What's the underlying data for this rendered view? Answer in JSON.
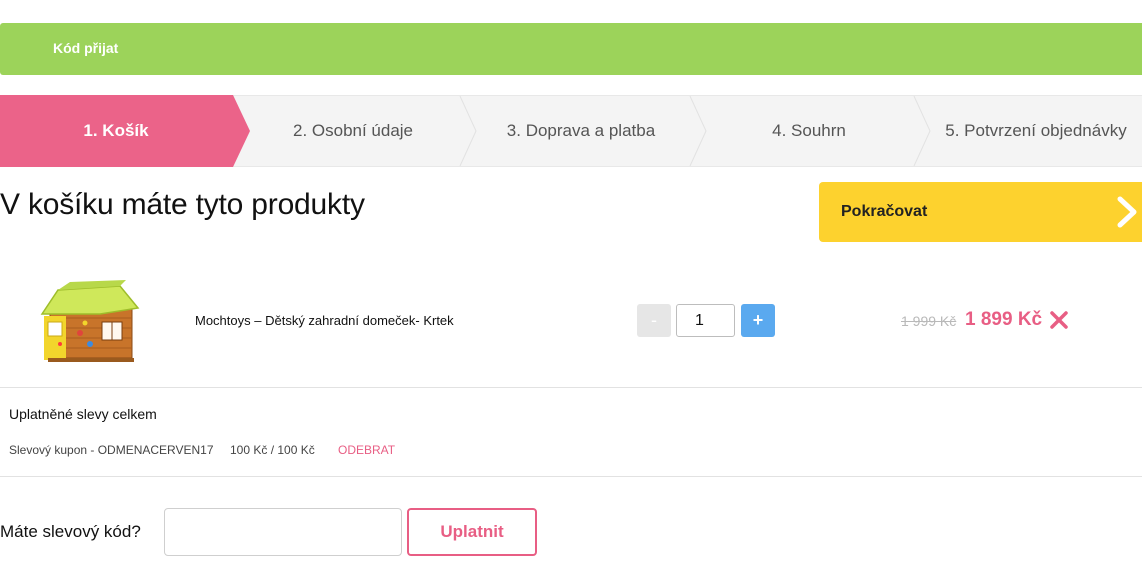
{
  "banner": {
    "text": "Kód přijat",
    "color": "#9cd35a"
  },
  "steps": [
    {
      "label": "1. Košík",
      "active": true
    },
    {
      "label": "2. Osobní údaje",
      "active": false
    },
    {
      "label": "3. Doprava a platba",
      "active": false
    },
    {
      "label": "4. Souhrn",
      "active": false
    },
    {
      "label": "5. Potvrzení objednávky",
      "active": false
    }
  ],
  "cart": {
    "title": "V košíku máte tyto produkty",
    "continue_label": "Pokračovat",
    "product": {
      "name": "Mochtoys – Dětský zahradní domeček- Krtek",
      "image_icon": "playhouse-image",
      "qty_minus": "-",
      "quantity": "1",
      "qty_plus": "+",
      "price_old": "1 999 Kč",
      "price_new": "1 899 Kč"
    }
  },
  "discounts": {
    "title": "Uplatněné slevy celkem",
    "coupon_text": "Slevový kupon - ODMENACERVEN17",
    "coupon_amount": "100 Kč / 100 Kč",
    "remove_label": "ODEBRAT"
  },
  "code_form": {
    "label": "Máte slevový kód?",
    "input_value": "",
    "apply_label": "Uplatnit"
  },
  "colors": {
    "accent_pink": "#e85e84",
    "continue_yellow": "#fdd22e",
    "plus_blue": "#5aa9ef"
  }
}
